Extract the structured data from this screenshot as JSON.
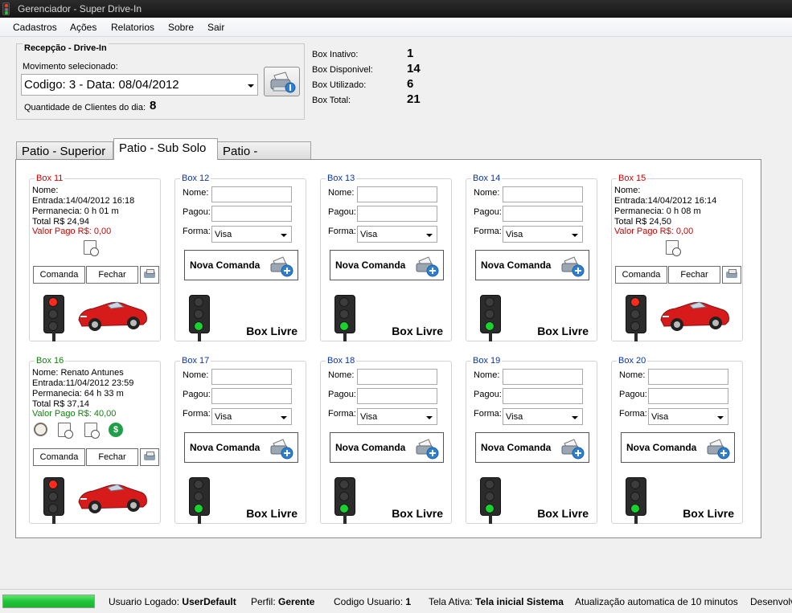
{
  "window": {
    "title": "Gerenciador - Super Drive-In"
  },
  "menu": {
    "items": [
      "Cadastros",
      "Ações",
      "Relatorios",
      "Sobre",
      "Sair"
    ]
  },
  "reception": {
    "title": "Recepção - Drive-In",
    "movement_label": "Movimento selecionado:",
    "movement_value": "Codigo: 3 - Data: 08/04/2012",
    "clients_label": "Quantidade de Clientes do dia:",
    "clients_count": "8"
  },
  "stats": [
    {
      "label": "Box Inativo:",
      "value": "1"
    },
    {
      "label": "Box Disponivel:",
      "value": "14"
    },
    {
      "label": "Box Utilizado:",
      "value": "6"
    },
    {
      "label": "Box Total:",
      "value": "21"
    }
  ],
  "tabs": [
    "Patio - Superior",
    "Patio - Sub Solo",
    "Patio - Varanda"
  ],
  "labels": {
    "nome": "Nome:",
    "pagou": "Pagou:",
    "forma": "Forma:",
    "forma_default": "Visa",
    "nova_comanda": "Nova Comanda",
    "box_livre": "Box Livre",
    "comanda": "Comanda",
    "fechar": "Fechar"
  },
  "occupied": {
    "box11": {
      "title": "Box 11",
      "nome": "Nome:",
      "entrada": "Entrada:14/04/2012 16:18",
      "permanencia": "Permanecia: 0 h 01 m",
      "total": "Total R$ 24,94",
      "valor_pago": "Valor Pago R$: 0,00"
    },
    "box15": {
      "title": "Box 15",
      "nome": "Nome:",
      "entrada": "Entrada:14/04/2012 16:14",
      "permanencia": "Permanecia: 0 h 08 m",
      "total": "Total R$ 24,50",
      "valor_pago": "Valor Pago R$: 0,00"
    },
    "box16": {
      "title": "Box 16",
      "nome": "Nome: Renato Antunes",
      "entrada": "Entrada:11/04/2012 23:59",
      "permanencia": "Permanecia: 64 h 33 m",
      "total": "Total R$ 37,14",
      "valor_pago": "Valor Pago R$: 40,00"
    }
  },
  "free_boxes": {
    "box12": "Box 12",
    "box13": "Box 13",
    "box14": "Box 14",
    "box17": "Box 17",
    "box18": "Box 18",
    "box19": "Box 19",
    "box20": "Box 20"
  },
  "status": {
    "progress": 1.0,
    "usuario_label": "Usuario Logado:",
    "usuario": "UserDefault",
    "perfil_label": "Perfil:",
    "perfil": "Gerente",
    "codigo_label": "Codigo Usuario:",
    "codigo": "1",
    "tela_label": "Tela Ativa:",
    "tela": "Tela inicial Sistema",
    "atualizacao": "Atualização automatica de 10 minutos",
    "desenvolv": "Desenvolv"
  },
  "colors": {
    "free_title": "#0a34a8",
    "pending_title": "#d20000",
    "paid_title": "#137f10",
    "light_red": "#ff2a1a",
    "light_green": "#18d22d"
  }
}
